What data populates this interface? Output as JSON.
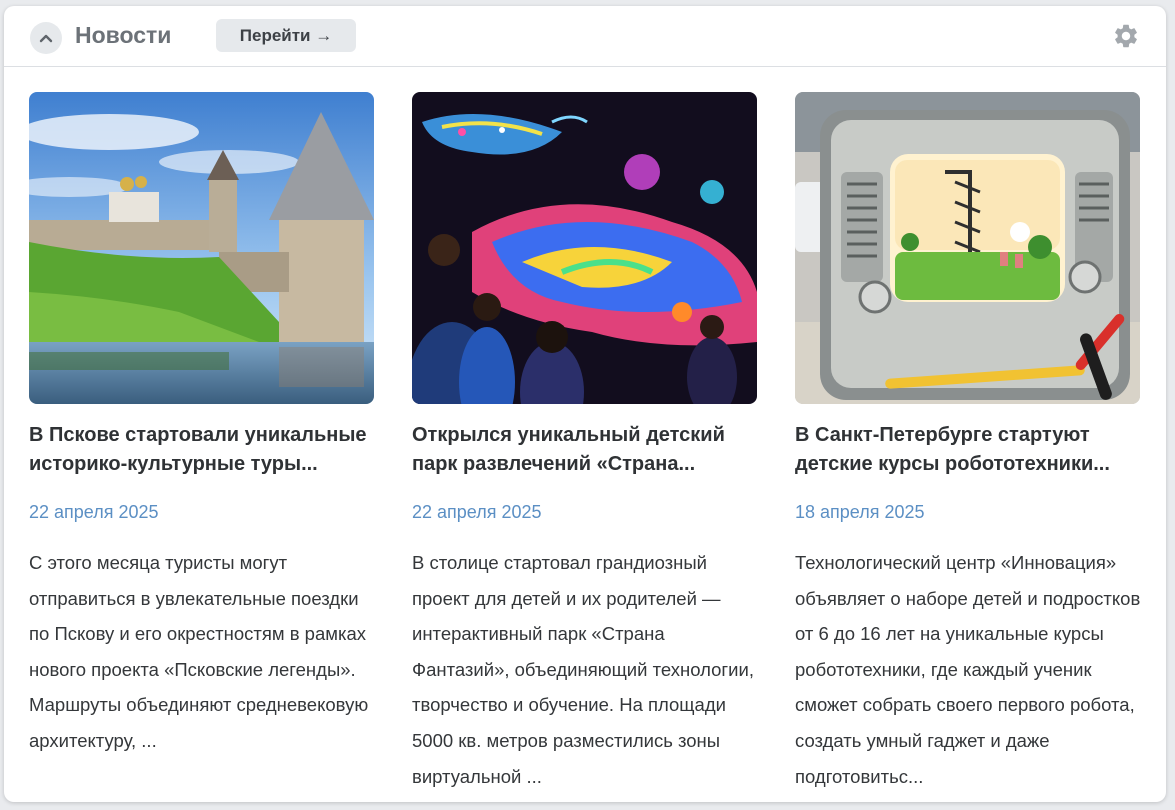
{
  "header": {
    "title": "Новости",
    "go_button": "Перейти →"
  },
  "colors": {
    "date": "#5b8fc4",
    "title_gray": "#6c7278",
    "button_bg": "#e6e9ec"
  },
  "icons": {
    "collapse": "chevron-up-icon",
    "settings": "gear-icon"
  },
  "news": [
    {
      "headline": "В Пскове стартовали уникальные историко-культурные туры...",
      "date": "22 апреля 2025",
      "text": "С этого месяца туристы могут отправиться в увлекательные поездки по Пскову и его окрестностям в рамках нового проекта «Псковские легенды». Маршруты объединяют средневековую архитектуру, ..."
    },
    {
      "headline": "Открылся уникальный детский парк развлечений «Страна...",
      "date": "22 апреля 2025",
      "text": "В столице стартовал грандиозный проект для детей и их родителей — интерактивный парк «Страна Фантазий», объединяющий технологии, творчество и обучение. На площади 5000 кв. метров разместились зоны виртуальной ..."
    },
    {
      "headline": "В Санкт-Петербурге стартуют детские курсы робототехники...",
      "date": "18 апреля 2025",
      "text": "Технологический центр «Инновация» объявляет о наборе детей и подростков от 6 до 16 лет на уникальные курсы робототехники, где каждый ученик сможет собрать своего первого робота, создать умный гаджет и даже подготовитьс..."
    }
  ]
}
